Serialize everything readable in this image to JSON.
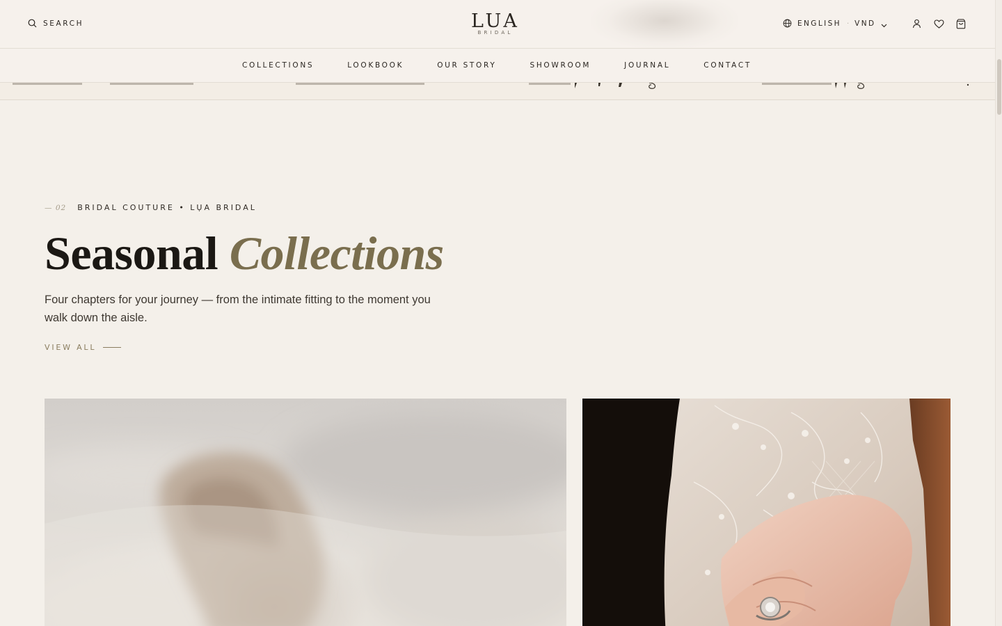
{
  "header": {
    "search_label": "SEARCH",
    "logo_main": "LUA",
    "logo_sub": "BRIDAL",
    "language": "ENGLISH",
    "separator": "·",
    "currency": "VND"
  },
  "nav": {
    "items": [
      "COLLECTIONS",
      "LOOKBOOK",
      "OUR STORY",
      "SHOWROOM",
      "JOURNAL",
      "CONTACT"
    ]
  },
  "section": {
    "number": "— 02",
    "eyebrow": "BRIDAL COUTURE • LỤA BRIDAL",
    "title_plain": "Seasonal",
    "title_accent": "Collections",
    "description": "Four chapters for your journey — from the intimate fitting to the moment you walk down the aisle.",
    "cta": "VIEW ALL"
  },
  "colors": {
    "background": "#f4f0ea",
    "accent": "#7a6e4e",
    "text": "#1b1814"
  },
  "icons": [
    "search-icon",
    "globe-icon",
    "chevron-down-icon",
    "user-icon",
    "heart-icon",
    "bag-icon"
  ]
}
